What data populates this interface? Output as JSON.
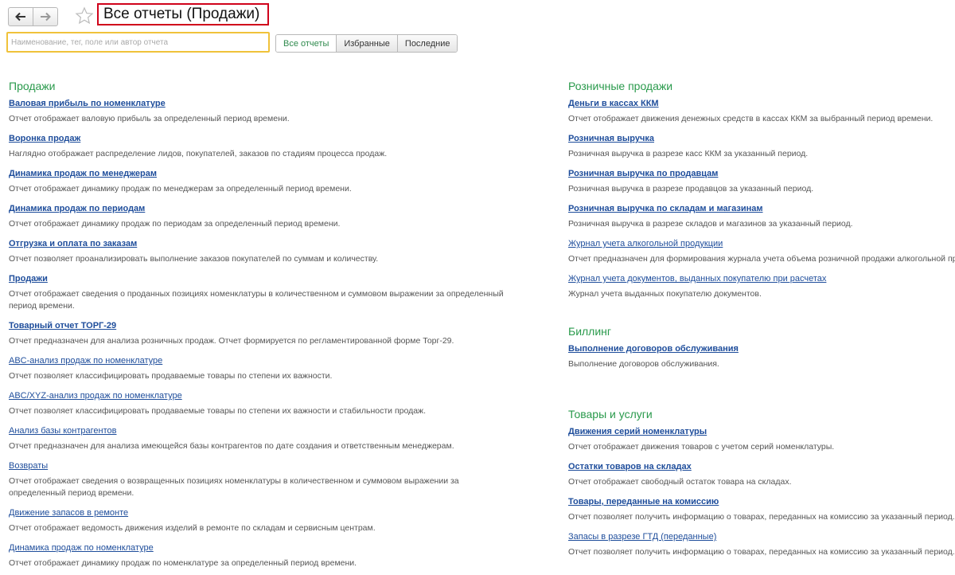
{
  "header": {
    "title": "Все отчеты (Продажи)"
  },
  "search": {
    "placeholder": "Наименование, тег, поле или автор отчета"
  },
  "tabs": [
    {
      "label": "Все отчеты"
    },
    {
      "label": "Избранные"
    },
    {
      "label": "Последние"
    }
  ],
  "colors": {
    "section_title": "#2a9a4c",
    "link": "#1e4d9b",
    "highlight_border": "#d0021b",
    "search_border": "#f0c23a"
  },
  "left": {
    "sales": {
      "title": "Продажи",
      "items": [
        {
          "label": "Валовая прибыль по номенклатуре",
          "desc": "Отчет отображает валовую прибыль за определенный период времени."
        },
        {
          "label": "Воронка продаж",
          "desc": "Наглядно отображает распределение лидов, покупателей, заказов по стадиям процесса продаж."
        },
        {
          "label": "Динамика продаж по менеджерам",
          "desc": "Отчет отображает динамику продаж по менеджерам за определенный период времени."
        },
        {
          "label": "Динамика продаж по периодам",
          "desc": "Отчет отображает динамику продаж по периодам за определенный период времени."
        },
        {
          "label": "Отгрузка и оплата по заказам",
          "desc": "Отчет позволяет проанализировать выполнение заказов покупателей по суммам и количеству."
        },
        {
          "label": "Продажи",
          "desc": "Отчет отображает сведения о проданных позициях номенклатуры в количественном и суммовом выражении за определенный период времени."
        },
        {
          "label": "Товарный отчет ТОРГ-29",
          "desc": "Отчет предназначен для анализа розничных продаж. Отчет формируется по регламентированной форме Торг-29."
        },
        {
          "label": "ABC-анализ продаж по номенклатуре",
          "desc": "Отчет позволяет классифицировать продаваемые товары по степени их важности."
        },
        {
          "label": "ABC/XYZ-анализ продаж по номенклатуре",
          "desc": "Отчет позволяет классифицировать продаваемые товары по степени их важности и стабильности продаж."
        },
        {
          "label": "Анализ базы контрагентов",
          "desc": "Отчет предназначен для анализа имеющейся базы контрагентов по дате создания и ответственным менеджерам."
        },
        {
          "label": "Возвраты",
          "desc": "Отчет отображает сведения о возвращенных позициях номенклатуры в количественном и суммовом выражении за определенный период времени."
        },
        {
          "label": "Движение запасов в ремонте",
          "desc": "Отчет отображает ведомость движения изделий в ремонте по складам и сервисным центрам."
        },
        {
          "label": "Динамика продаж по номенклатуре",
          "desc": "Отчет отображает динамику продаж по номенклатуре за определенный период времени."
        }
      ]
    }
  },
  "right": {
    "retail": {
      "title": "Розничные продажи",
      "items": [
        {
          "label": "Деньги в кассах ККМ",
          "desc": "Отчет отображает движения денежных средств в кассах ККМ за выбранный период времени."
        },
        {
          "label": "Розничная выручка",
          "desc": "Розничная выручка в разрезе касс ККМ за указанный период."
        },
        {
          "label": "Розничная выручка по продавцам",
          "desc": "Розничная выручка в разрезе продавцов за указанный период."
        },
        {
          "label": "Розничная выручка по складам и магазинам",
          "desc": "Розничная выручка в разрезе складов и магазинов за указанный период."
        },
        {
          "label": "Журнал учета алкогольной продукции",
          "desc": "Отчет предназначен для формирования журнала учета объема розничной продажи алкогольной продукции."
        },
        {
          "label": "Журнал учета документов, выданных покупателю при расчетах",
          "desc": "Журнал учета выданных покупателю документов."
        }
      ]
    },
    "billing": {
      "title": "Биллинг",
      "items": [
        {
          "label": "Выполнение договоров обслуживания",
          "desc": "Выполнение договоров обслуживания."
        }
      ]
    },
    "goods": {
      "title": "Товары и услуги",
      "items": [
        {
          "label": "Движения серий номенклатуры",
          "desc": "Отчет отображает движения товаров с учетом серий номенклатуры."
        },
        {
          "label": "Остатки товаров на складах",
          "desc": "Отчет отображает свободный остаток товара на складах."
        },
        {
          "label": "Товары, переданные на комиссию",
          "desc": "Отчет позволяет получить информацию о товарах, переданных на комиссию за указанный период."
        },
        {
          "label": "Запасы в разрезе ГТД (переданные)",
          "desc": "Отчет позволяет получить информацию о товарах, переданных на комиссию за указанный период."
        }
      ]
    }
  }
}
